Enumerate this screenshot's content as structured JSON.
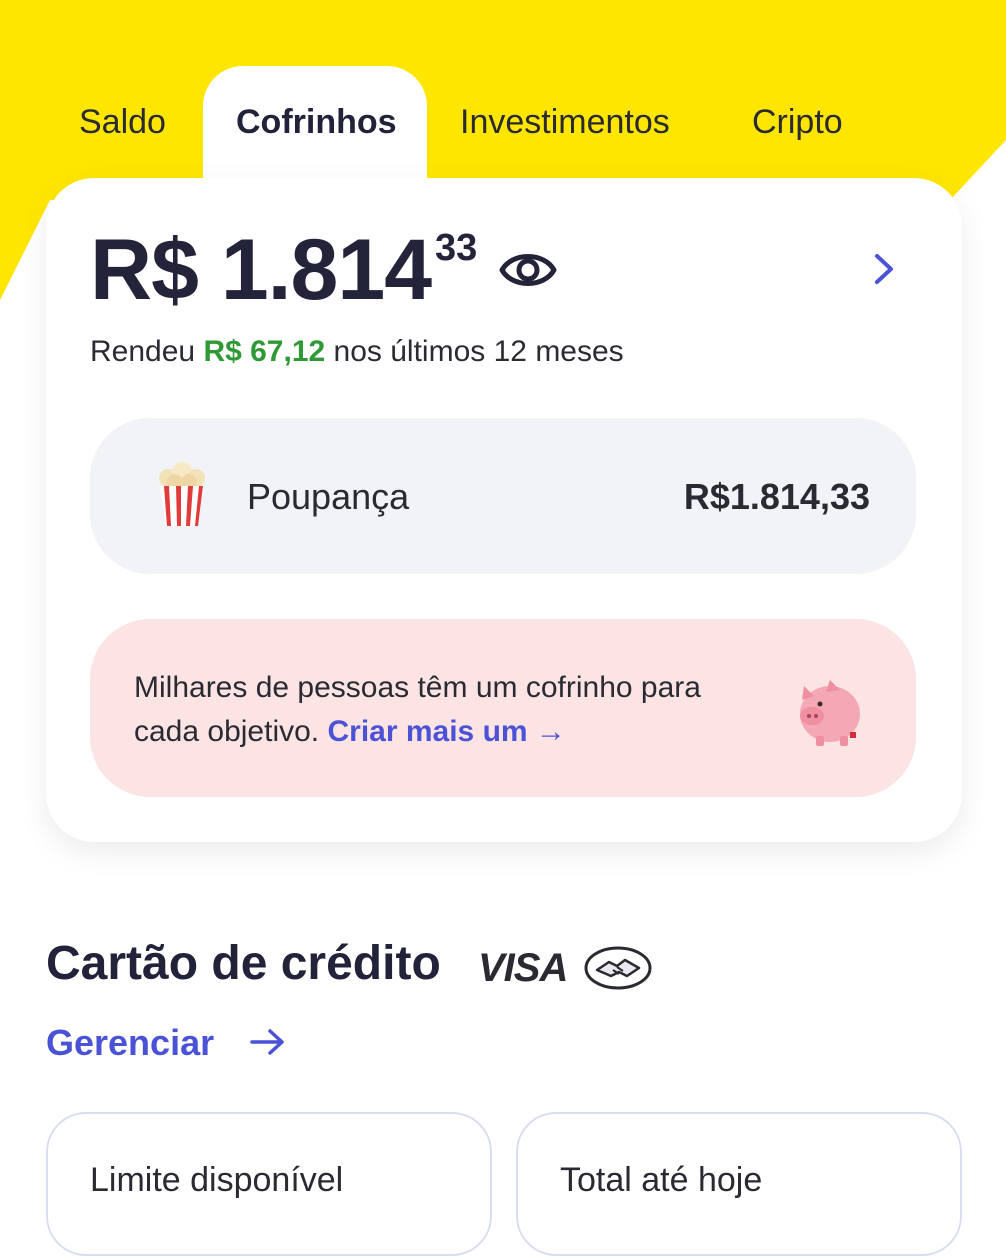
{
  "colors": {
    "brand_yellow": "#ffe600",
    "accent_blue": "#4a52d6",
    "positive_green": "#2f9a35",
    "promo_pink": "#fde4e4",
    "row_gray": "#f2f3f7"
  },
  "tabs": [
    {
      "label": "Saldo",
      "active": false
    },
    {
      "label": "Cofrinhos",
      "active": true
    },
    {
      "label": "Investimentos",
      "active": false
    },
    {
      "label": "Cripto",
      "active": false
    }
  ],
  "balance": {
    "main": "R$ 1.814",
    "cents": "33",
    "visibility_icon": "eye-icon",
    "details_icon": "chevron-right-icon"
  },
  "yield": {
    "prefix": "Rendeu",
    "amount": "R$ 67,12",
    "suffix": "nos últimos 12 meses"
  },
  "savings": [
    {
      "icon": "popcorn-icon",
      "name": "Poupança",
      "value": "R$1.814,33"
    }
  ],
  "promo": {
    "text": "Milhares de pessoas têm um cofrinho para cada objetivo.",
    "link": "Criar mais um →",
    "icon": "piggy-bank-icon"
  },
  "credit_card": {
    "title": "Cartão de crédito",
    "brand": "VISA",
    "issuer_icon": "handshake-logo-icon",
    "manage_label": "Gerenciar",
    "limit_label": "Limite disponível",
    "total_label": "Total até hoje"
  }
}
